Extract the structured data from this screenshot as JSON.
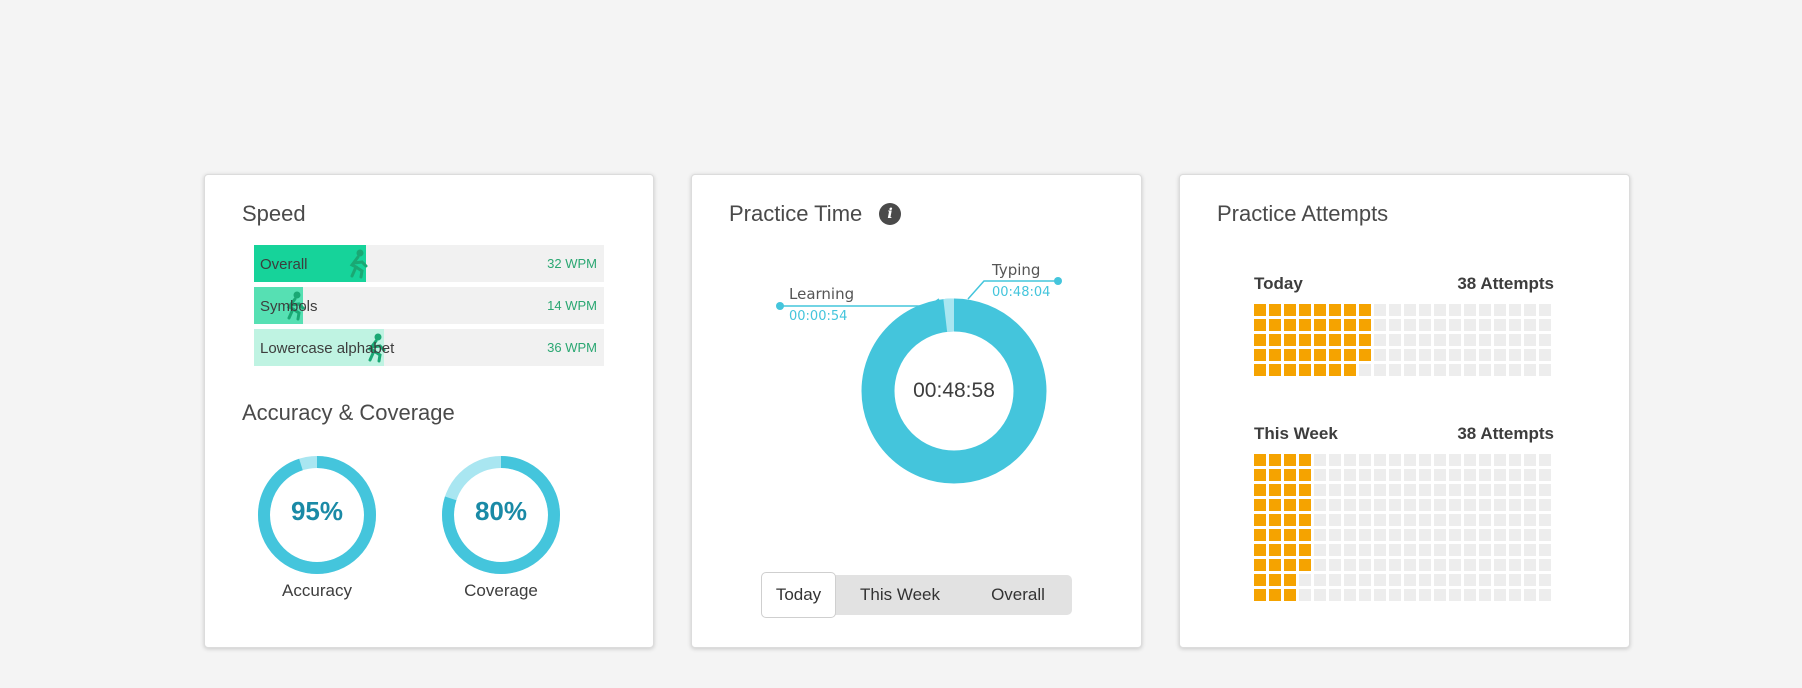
{
  "speed": {
    "title": "Speed",
    "items": [
      {
        "label": "Overall",
        "value": "32 WPM",
        "fill": 0.32,
        "color": "#16d39a"
      },
      {
        "label": "Symbols",
        "value": "14 WPM",
        "fill": 0.14,
        "color": "#56e0b3"
      },
      {
        "label": "Lowercase alphabet",
        "value": "36 WPM",
        "fill": 0.37,
        "color": "#bff3e2"
      }
    ]
  },
  "accuracy": {
    "title": "Accuracy & Coverage",
    "accuracy_label": "Accuracy",
    "accuracy_value": "95%",
    "accuracy_fraction": 0.95,
    "coverage_label": "Coverage",
    "coverage_value": "80%",
    "coverage_fraction": 0.8,
    "ring_color": "#44c5dc",
    "track_color": "#a9e6f1"
  },
  "practice_time": {
    "title": "Practice Time",
    "info_icon": "info-icon",
    "total": "00:48:58",
    "chart_data": {
      "type": "pie",
      "categories": [
        "Typing",
        "Learning"
      ],
      "values": [
        "00:48:04",
        "00:00:54"
      ],
      "values_seconds": [
        2884,
        54
      ],
      "colors": [
        "#44c5dc",
        "#a9e6f1"
      ]
    },
    "tabs": [
      {
        "label": "Today",
        "active": true
      },
      {
        "label": "This Week",
        "active": false
      },
      {
        "label": "Overall",
        "active": false
      }
    ]
  },
  "attempts": {
    "title": "Practice Attempts",
    "today": {
      "label": "Today",
      "count": "38 Attempts",
      "filled": 38,
      "rows": 5,
      "cols": 20,
      "columns_filled": [
        5,
        5,
        5,
        5,
        5,
        5,
        5,
        4
      ]
    },
    "week": {
      "label": "This Week",
      "count": "38 Attempts",
      "filled": 38,
      "rows": 10,
      "cols": 20,
      "columns_filled": [
        10,
        10,
        10,
        8
      ]
    },
    "filled_color": "#f5a300",
    "empty_color": "#ededed"
  }
}
